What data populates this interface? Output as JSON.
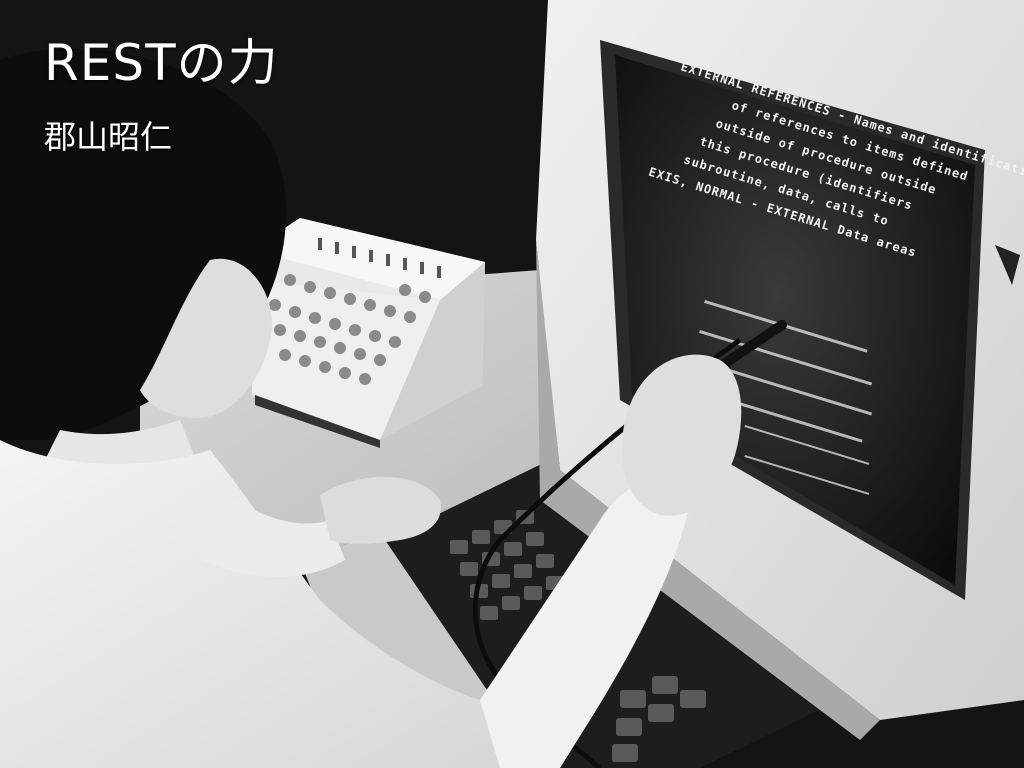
{
  "slide": {
    "title": "RESTの力",
    "author": "郡山昭仁"
  },
  "screen": {
    "lines": [
      "EXTERNAL REFERENCES - Names and identification",
      "of references to items defined",
      "outside of procedure outside",
      "this procedure (identifiers",
      "subroutine, data, calls to",
      "EXIS, NORMAL - EXTERNAL Data areas"
    ]
  }
}
